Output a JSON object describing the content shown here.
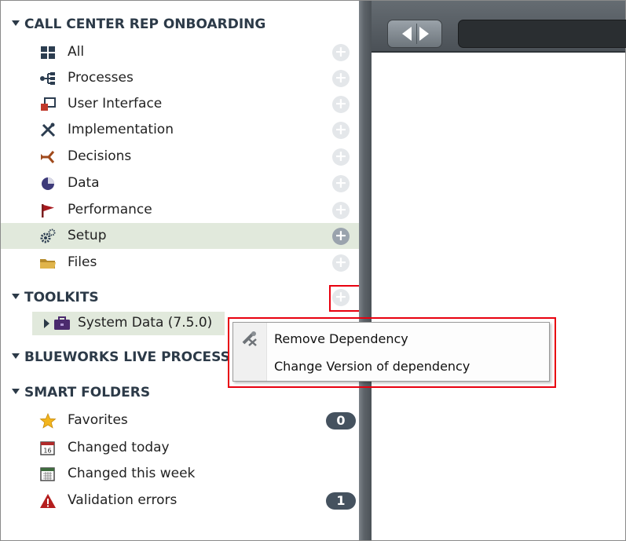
{
  "sidebar": {
    "project": {
      "title": "CALL CENTER REP ONBOARDING",
      "items": [
        {
          "label": "All",
          "icon": "grid-icon"
        },
        {
          "label": "Processes",
          "icon": "process-icon"
        },
        {
          "label": "User Interface",
          "icon": "user-interface-icon"
        },
        {
          "label": "Implementation",
          "icon": "tools-icon"
        },
        {
          "label": "Decisions",
          "icon": "decision-icon"
        },
        {
          "label": "Data",
          "icon": "data-icon"
        },
        {
          "label": "Performance",
          "icon": "flag-icon"
        },
        {
          "label": "Setup",
          "icon": "gears-icon",
          "selected": true
        },
        {
          "label": "Files",
          "icon": "folder-icon"
        }
      ]
    },
    "toolkits": {
      "title": "TOOLKITS",
      "items": [
        {
          "label": "System Data (7.5.0)",
          "icon": "toolkit-icon"
        }
      ]
    },
    "blueworks": {
      "title": "BLUEWORKS LIVE PROCESS"
    },
    "smart_folders": {
      "title": "SMART FOLDERS",
      "items": [
        {
          "label": "Favorites",
          "icon": "star-icon",
          "count": "0"
        },
        {
          "label": "Changed today",
          "icon": "calendar-day-icon",
          "day": "16"
        },
        {
          "label": "Changed this week",
          "icon": "calendar-week-icon"
        },
        {
          "label": "Validation errors",
          "icon": "warning-icon",
          "count": "1"
        }
      ]
    }
  },
  "context_menu": {
    "items": [
      {
        "label": "Remove Dependency",
        "icon": "remove-dependency-icon"
      },
      {
        "label": "Change Version of dependency"
      }
    ]
  },
  "toolbar": {
    "back": "back-arrow-icon",
    "forward": "forward-arrow-icon"
  },
  "colors": {
    "section_text": "#2c3a48",
    "selected_row": "#e1e9dc",
    "badge": "#45525f",
    "highlight": "#e8000f"
  }
}
